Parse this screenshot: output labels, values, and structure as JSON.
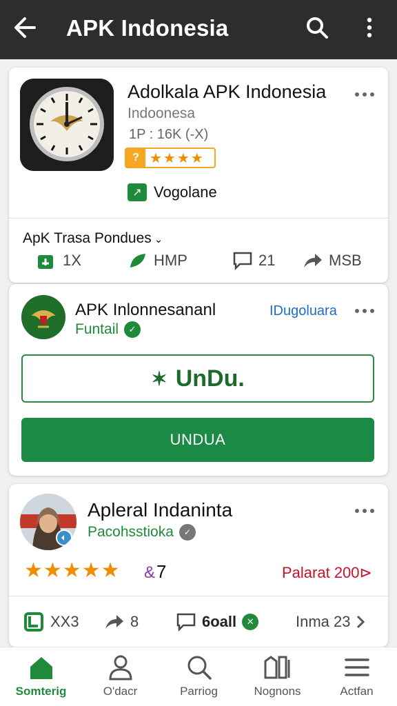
{
  "app_bar": {
    "title": "APK Indonesia"
  },
  "card1": {
    "name": "Adolkala APK Indonesia",
    "subtitle": "Indoonesa",
    "stat": "1P : 16K (-X)",
    "publisher": "Vogolane",
    "section_label": "ApK Trasa Pondues",
    "actions": [
      {
        "icon": "thumbs-up-icon",
        "label": "1X"
      },
      {
        "icon": "leaf-icon",
        "label": "HMP"
      },
      {
        "icon": "comment-icon",
        "label": "21"
      },
      {
        "icon": "share-icon",
        "label": "MSB"
      }
    ]
  },
  "card2": {
    "name": "APK Inlonnesananl",
    "subtitle": "Funtail",
    "tag": "IDugoluara",
    "outline_button": "UnDu.",
    "fill_button": "UNDUA"
  },
  "card3": {
    "name": "Apleral Indaninta",
    "subtitle": "Pacohsstioka",
    "rating_count": "7",
    "promo": "Palarat 200⊳",
    "actions": [
      {
        "icon": "check-badge-icon",
        "label": "XX3"
      },
      {
        "icon": "share-icon",
        "label": "8"
      },
      {
        "icon": "comment-icon",
        "label": "6oall"
      },
      {
        "icon": "chevron-right-icon",
        "label": "Inma 23"
      }
    ]
  },
  "bottom_nav": [
    {
      "icon": "home-icon",
      "label": "Somterig",
      "active": true
    },
    {
      "icon": "person-icon",
      "label": "O'dacr",
      "active": false
    },
    {
      "icon": "search-icon",
      "label": "Parriog",
      "active": false
    },
    {
      "icon": "apps-icon",
      "label": "Nognons",
      "active": false
    },
    {
      "icon": "menu-icon",
      "label": "Actfan",
      "active": false
    }
  ],
  "colors": {
    "brand_green": "#1a8a45",
    "star_orange": "#f08c00",
    "promo_red": "#c8102e",
    "link_blue": "#1e6ec8"
  }
}
